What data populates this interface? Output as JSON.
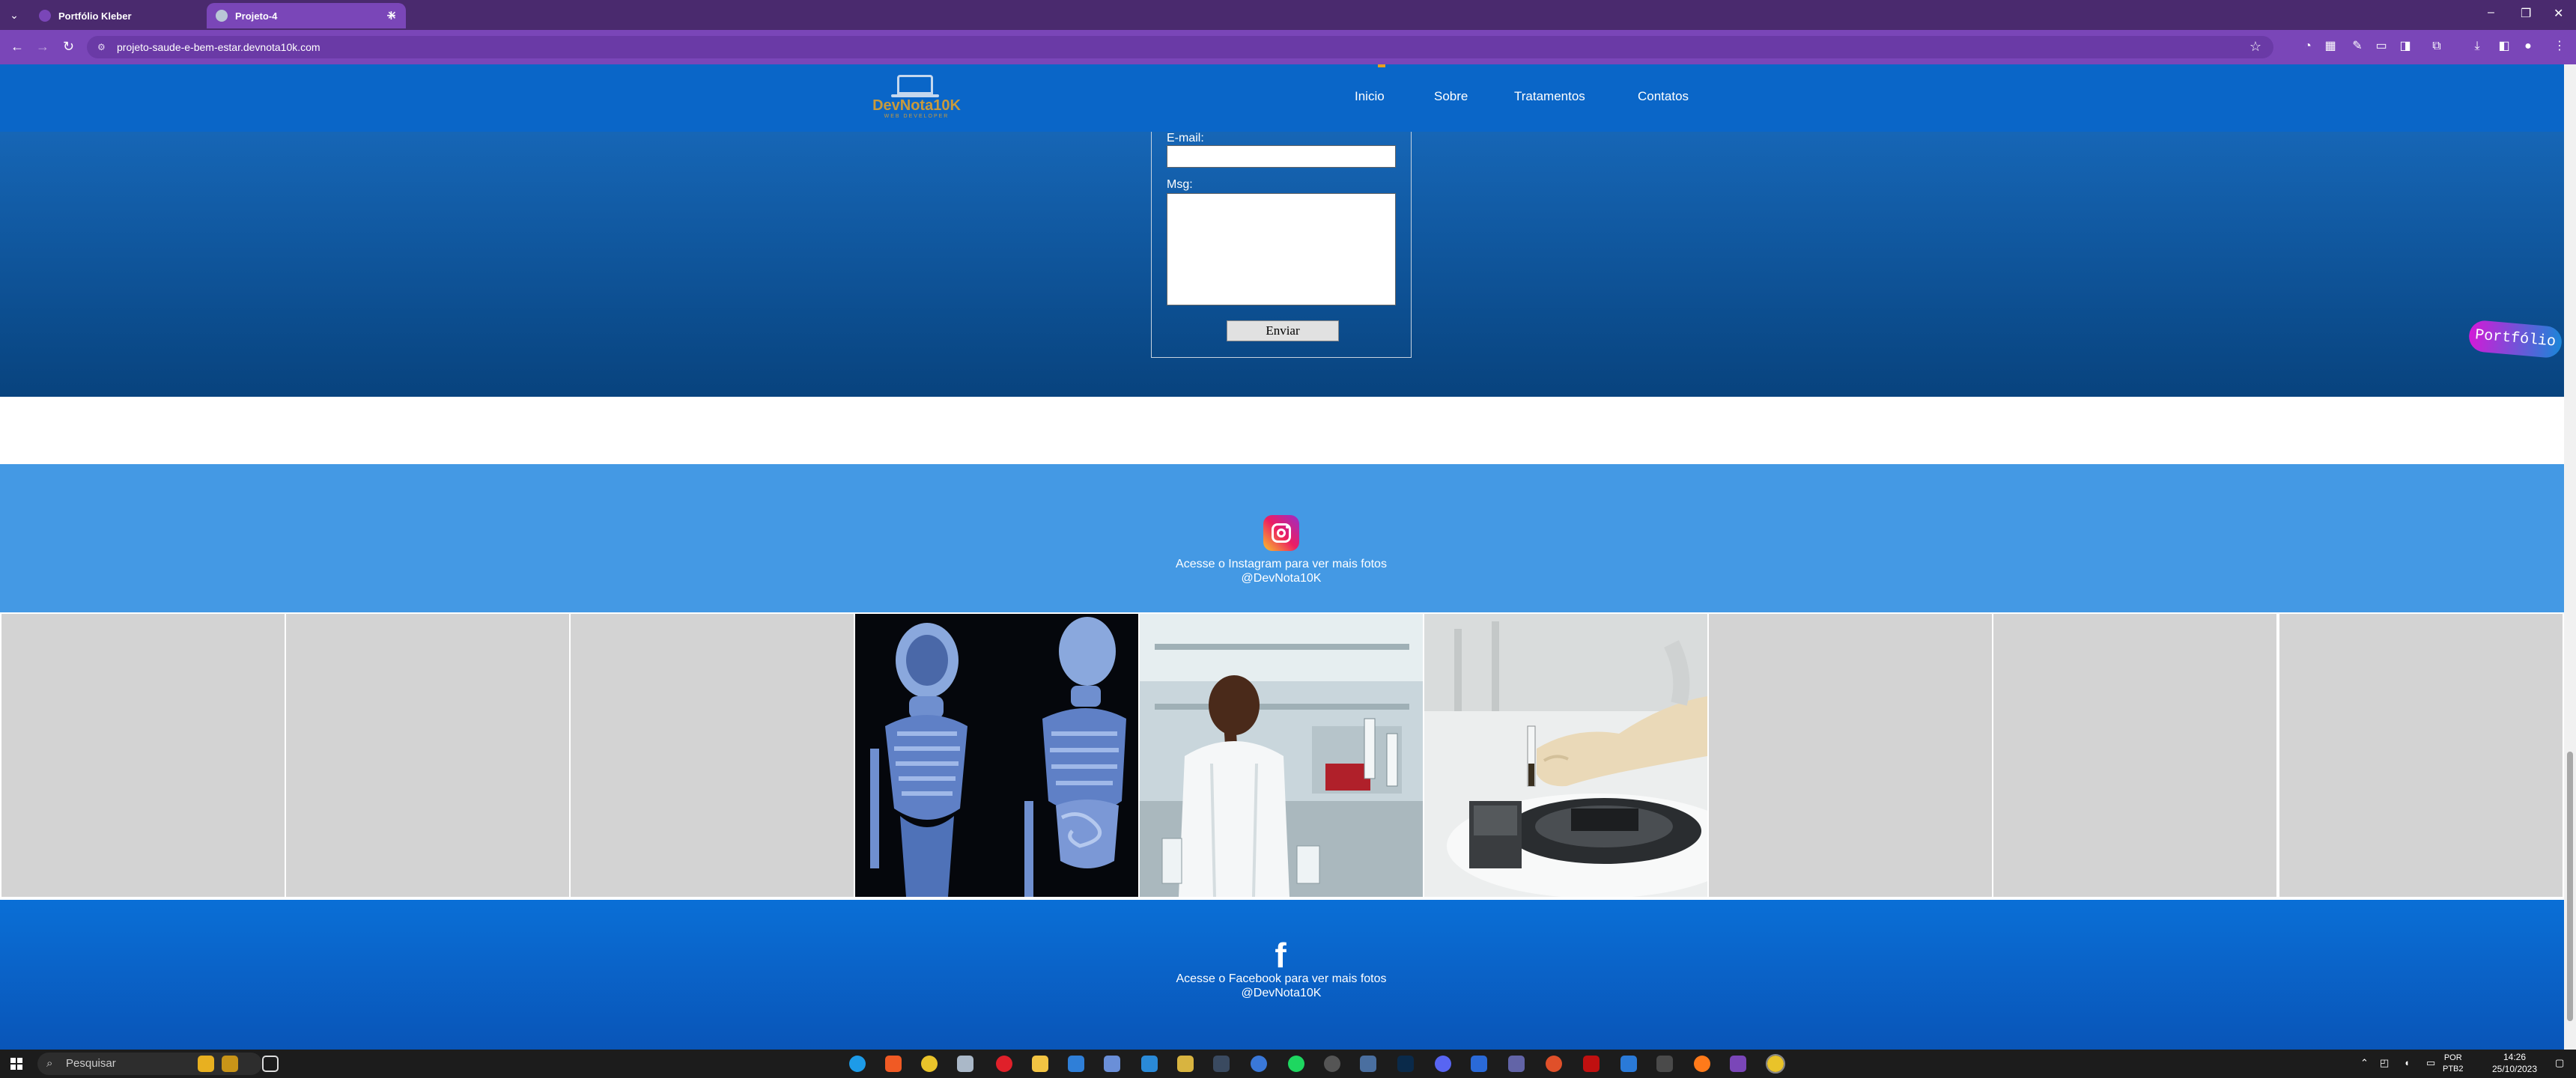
{
  "browser": {
    "tabs": [
      {
        "title": "Portfólio Kleber",
        "active": false
      },
      {
        "title": "Projeto-4",
        "active": true
      }
    ],
    "url": "projeto-saude-e-bem-estar.devnota10k.com",
    "new_tab_symbol": "+",
    "close_symbol": "✕",
    "back_symbol": "←",
    "forward_symbol": "→",
    "reload_symbol": "↻",
    "star_symbol": "☆",
    "menu_symbol": "⋮",
    "minimize_symbol": "–",
    "maximize_symbol": "❐"
  },
  "site": {
    "logo": {
      "brand": "DevNota10K",
      "tagline": "WEB DEVELOPER"
    },
    "nav": [
      "Inicio",
      "Sobre",
      "Tratamentos",
      "Contatos"
    ],
    "form": {
      "email_label": "E-mail:",
      "msg_label": "Msg:",
      "submit_label": "Enviar"
    },
    "portfolio_badge": "Portfólio",
    "instagram": {
      "caption": "Acesse o Instagram para ver mais fotos",
      "handle": "@DevNota10K"
    },
    "gallery": [
      {
        "image": "placeholder"
      },
      {
        "image": "placeholder"
      },
      {
        "image": "placeholder"
      },
      {
        "image": "skeleton-anatomy-render"
      },
      {
        "image": "laboratory-researcher"
      },
      {
        "image": "lab-centrifuge-gloved-hand"
      },
      {
        "image": "placeholder"
      },
      {
        "image": "placeholder"
      },
      {
        "image": "placeholder"
      }
    ],
    "facebook": {
      "caption": "Acesse o Facebook para ver mais fotos",
      "handle": "@DevNota10K"
    }
  },
  "taskbar": {
    "search_placeholder": "Pesquisar",
    "language": "POR",
    "layout": "PTB2",
    "time": "14:26",
    "date": "25/10/2023"
  },
  "colors": {
    "tab_bar": "#4a2a6e",
    "address_bar": "#7a46b8",
    "site_nav": "#0a66c8",
    "instagram_section": "#4499e4",
    "facebook_section": "#0a6fd6"
  }
}
